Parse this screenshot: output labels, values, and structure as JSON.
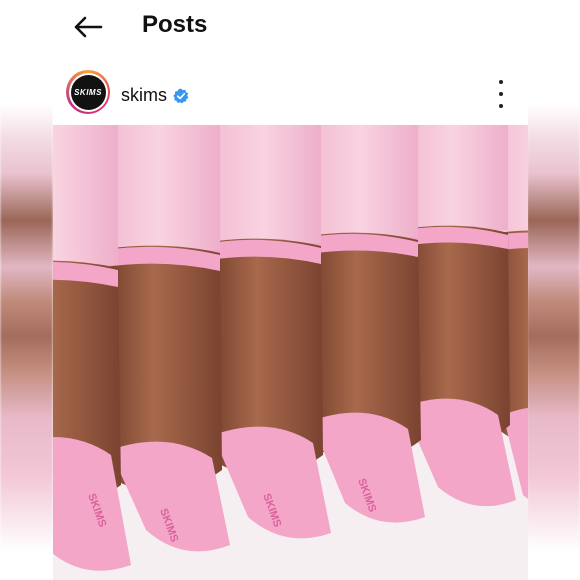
{
  "header": {
    "title": "Posts",
    "back_icon": "arrow-left-icon"
  },
  "post": {
    "username": "skims",
    "avatar_text": "SKIMS",
    "verified_icon": "verified-badge-icon",
    "more_icon": "more-vertical-icon",
    "image_text": "SKIMS"
  },
  "colors": {
    "accent_pink": "#f4a6c8",
    "verified_blue": "#3897f0",
    "skin": "#8a4f38"
  }
}
